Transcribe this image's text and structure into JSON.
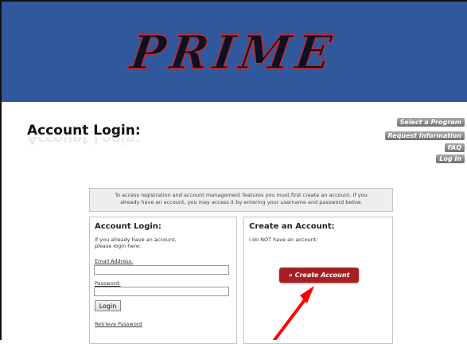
{
  "header": {
    "logo_text": "PRIME"
  },
  "page_title": "Account Login:",
  "side_nav": [
    {
      "label": "Select a Program"
    },
    {
      "label": "Request Information"
    },
    {
      "label": "FAQ"
    },
    {
      "label": "Log In"
    }
  ],
  "notice": {
    "line1": "To access registration and account management features you must first create an account. If you",
    "line2": "already have an account, you may access it by entering your username and password below."
  },
  "login_panel": {
    "title": "Account Login:",
    "intro_line1": "If you already have an account,",
    "intro_line2": "please login here:",
    "email_label": "Email Address:",
    "email_value": "",
    "password_label": "Password:",
    "password_value": "",
    "login_button": "Login",
    "retrieve_link": "Retrieve Password"
  },
  "create_panel": {
    "title": "Create an Account:",
    "intro": "I do NOT have an account:",
    "create_button": "» Create Account"
  },
  "colors": {
    "header_bg": "#30589c",
    "create_button_bg": "#a91e23",
    "annotation_arrow": "#ff0000"
  }
}
